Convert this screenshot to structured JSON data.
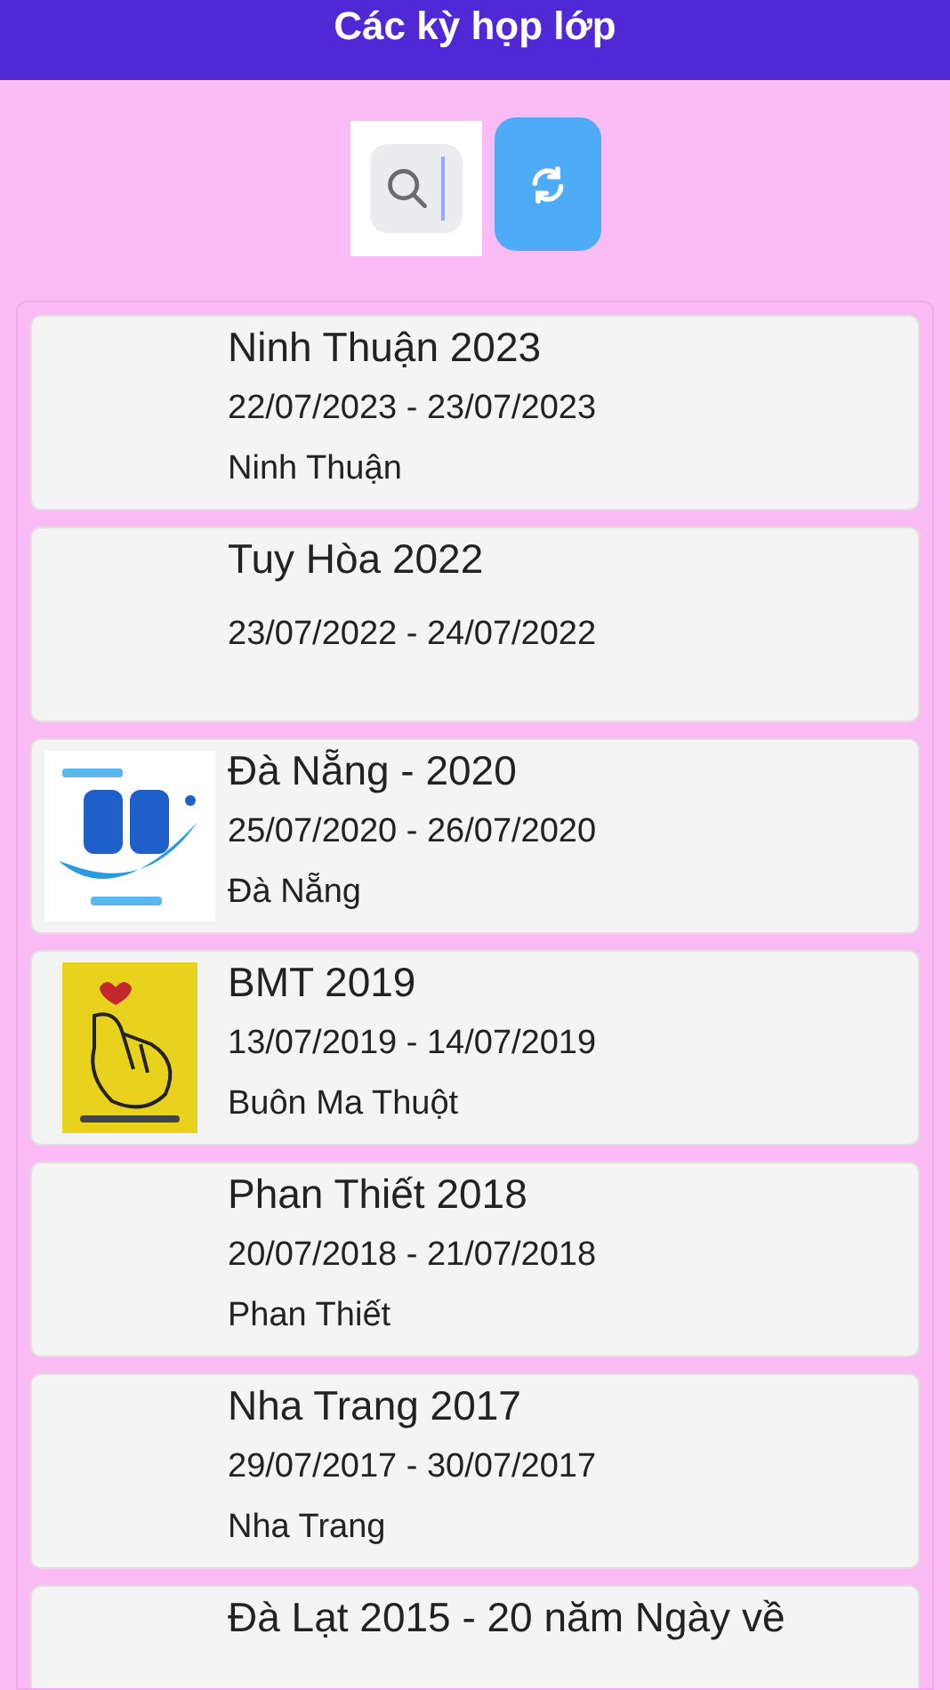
{
  "header": {
    "title": "Các kỳ họp lớp"
  },
  "events": [
    {
      "title": "Ninh Thuận 2023",
      "dates": "22/07/2023 - 23/07/2023",
      "place": "Ninh Thuận"
    },
    {
      "title": "Tuy Hòa 2022",
      "dates": "23/07/2022 - 24/07/2022"
    },
    {
      "title": "Đà Nẵng - 2020",
      "dates": "25/07/2020 - 26/07/2020",
      "place": "Đà Nẵng"
    },
    {
      "title": "BMT 2019",
      "dates": "13/07/2019 - 14/07/2019",
      "place": "Buôn Ma Thuột"
    },
    {
      "title": "Phan Thiết 2018",
      "dates": "20/07/2018 - 21/07/2018",
      "place": "Phan Thiết"
    },
    {
      "title": "Nha Trang 2017",
      "dates": "29/07/2017 - 30/07/2017",
      "place": "Nha Trang"
    },
    {
      "title": "Đà Lạt 2015 - 20 năm Ngày về"
    }
  ]
}
